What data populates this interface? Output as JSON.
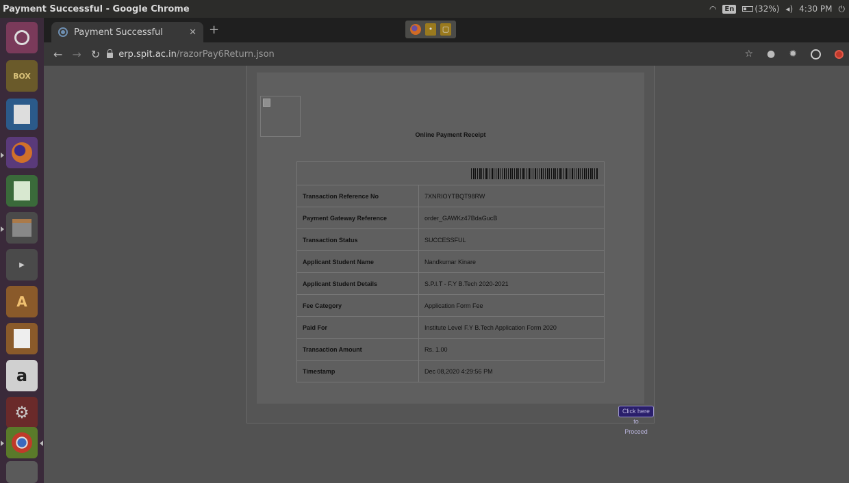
{
  "system": {
    "window_title": "Payment Successful - Google Chrome",
    "keyboard_layout": "En",
    "battery": "(32%)",
    "clock": "4:30 PM"
  },
  "launcher": {
    "items": [
      "ubuntu-dash",
      "dosbox",
      "document-viewer",
      "firefox",
      "spreadsheet",
      "file-manager",
      "video-editor",
      "software-center",
      "presentation",
      "amazon",
      "system-settings",
      "chrome",
      "drive"
    ]
  },
  "browser": {
    "tab_title": "Payment Successful",
    "url_host": "erp.spit.ac.in",
    "url_path": "/razorPay6Return.json"
  },
  "receipt": {
    "title": "Online Payment Receipt",
    "rows": [
      {
        "label": "Transaction Reference No",
        "value": "7XNRIOYTBQT98RW"
      },
      {
        "label": "Payment Gateway Reference",
        "value": "order_GAWKz47BdaGucB"
      },
      {
        "label": "Transaction Status",
        "value": "SUCCESSFUL"
      },
      {
        "label": "Applicant Student Name",
        "value": "Nandkumar Kinare"
      },
      {
        "label": "Applicant Student Details",
        "value": "S.P.I.T - F.Y B.Tech 2020-2021"
      },
      {
        "label": "Fee Category",
        "value": "Application Form Fee"
      },
      {
        "label": "Paid For",
        "value": "Institute Level F.Y B.Tech Application Form 2020"
      },
      {
        "label": "Transaction Amount",
        "value": "Rs. 1.00"
      },
      {
        "label": "Timestamp",
        "value": "Dec 08,2020 4:29:56 PM"
      }
    ],
    "proceed_label": "Click here to Proceed"
  }
}
